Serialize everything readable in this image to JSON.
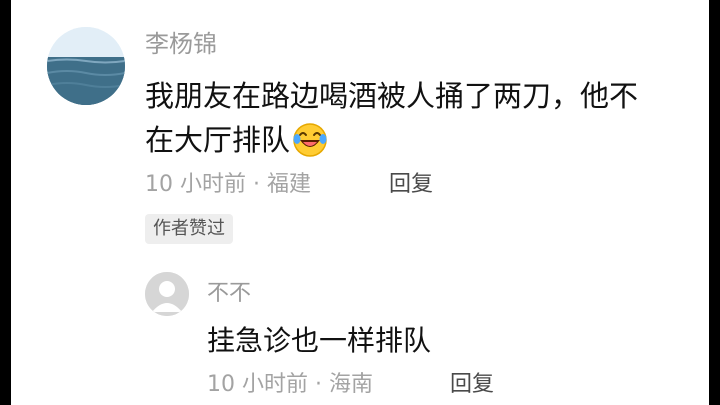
{
  "comment": {
    "username": "李杨锦",
    "text_line1": "我朋友在路边喝酒被人捅了两刀，他不",
    "text_line2": "在大厅排队",
    "emoji": "laughing-crying-emoji",
    "time_location": "10 小时前 · 福建",
    "reply_label": "回复",
    "author_liked_badge": "作者赞过"
  },
  "reply": {
    "username": "不不",
    "text": "挂急诊也一样排队",
    "time_location": "10 小时前 · 海南",
    "reply_label": "回复"
  }
}
